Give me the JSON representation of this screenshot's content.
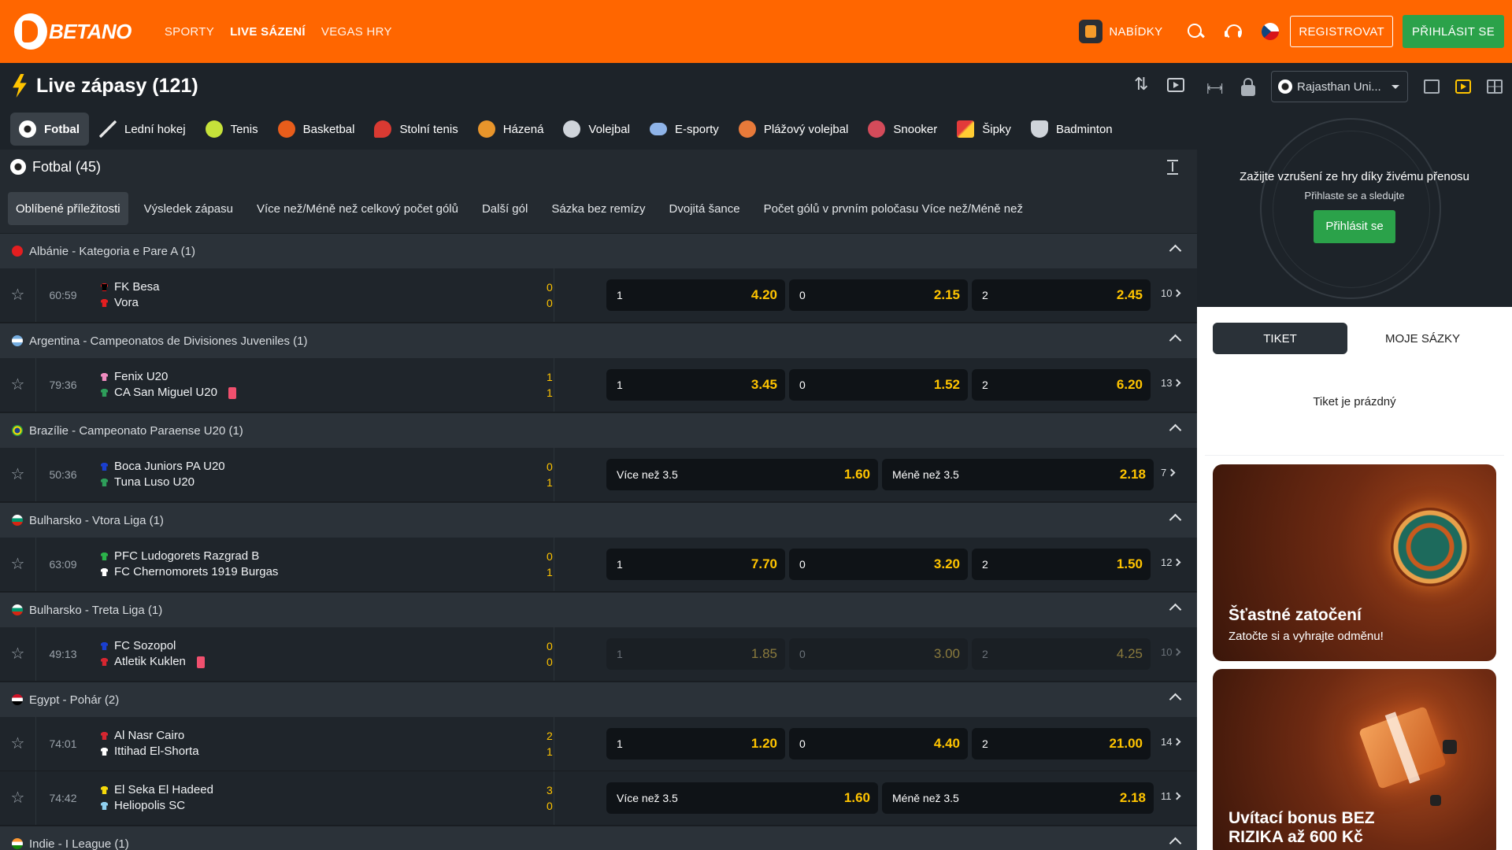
{
  "header": {
    "logo_text": "BETANO",
    "nav": [
      "SPORTY",
      "LIVE SÁZENÍ",
      "VEGAS HRY"
    ],
    "offers_label": "NABÍDKY",
    "register_label": "REGISTROVAT",
    "login_label": "PŘIHLÁSIT SE"
  },
  "live": {
    "title": "Live zápasy (121)"
  },
  "sport_tabs": [
    "Fotbal",
    "Lední hokej",
    "Tenis",
    "Basketbal",
    "Stolní tenis",
    "Házená",
    "Volejbal",
    "E-sporty",
    "Plážový volejbal",
    "Snooker",
    "Šipky",
    "Badminton"
  ],
  "section": {
    "title": "Fotbal (45)"
  },
  "market_tabs": [
    "Oblíbené příležitosti",
    "Výsledek zápasu",
    "Více než/Méně než celkový počet gólů",
    "Další gól",
    "Sázka bez remízy",
    "Dvojitá šance",
    "Počet gólů v prvním poločasu Více než/Méně než"
  ],
  "leagues": [
    {
      "name": "Albánie - Kategoria e Pare A (1)",
      "matches": [
        {
          "time": "60:59",
          "home": "FK Besa",
          "away": "Vora",
          "home_score": "0",
          "away_score": "0",
          "odds": [
            {
              "label": "1",
              "value": "4.20"
            },
            {
              "label": "0",
              "value": "2.15"
            },
            {
              "label": "2",
              "value": "2.45"
            }
          ],
          "more": "10"
        }
      ]
    },
    {
      "name": "Argentina - Campeonatos de Divisiones Juveniles (1)",
      "matches": [
        {
          "time": "79:36",
          "home": "Fenix U20",
          "away": "CA San Miguel U20",
          "home_score": "1",
          "away_score": "1",
          "odds": [
            {
              "label": "1",
              "value": "3.45"
            },
            {
              "label": "0",
              "value": "1.52"
            },
            {
              "label": "2",
              "value": "6.20"
            }
          ],
          "more": "13"
        }
      ]
    },
    {
      "name": "Brazílie - Campeonato Paraense U20 (1)",
      "matches": [
        {
          "time": "50:36",
          "home": "Boca Juniors PA U20",
          "away": "Tuna Luso U20",
          "home_score": "0",
          "away_score": "1",
          "odds": [
            {
              "label": "Více než 3.5",
              "value": "1.60"
            },
            {
              "label": "Méně než 3.5",
              "value": "2.18"
            }
          ],
          "more": "7"
        }
      ]
    },
    {
      "name": "Bulharsko - Vtora Liga (1)",
      "matches": [
        {
          "time": "63:09",
          "home": "PFC Ludogorets Razgrad B",
          "away": "FC Chernomorets 1919 Burgas",
          "home_score": "0",
          "away_score": "1",
          "odds": [
            {
              "label": "1",
              "value": "7.70"
            },
            {
              "label": "0",
              "value": "3.20"
            },
            {
              "label": "2",
              "value": "1.50"
            }
          ],
          "more": "12"
        }
      ]
    },
    {
      "name": "Bulharsko - Treta Liga (1)",
      "matches": [
        {
          "time": "49:13",
          "home": "FC Sozopol",
          "away": "Atletik Kuklen",
          "home_score": "0",
          "away_score": "0",
          "odds": [
            {
              "label": "1",
              "value": "1.85"
            },
            {
              "label": "0",
              "value": "3.00"
            },
            {
              "label": "2",
              "value": "4.25"
            }
          ],
          "more": "10"
        }
      ]
    },
    {
      "name": "Egypt - Pohár (2)",
      "matches": [
        {
          "time": "74:01",
          "home": "Al Nasr Cairo",
          "away": "Ittihad El-Shorta",
          "home_score": "2",
          "away_score": "1",
          "odds": [
            {
              "label": "1",
              "value": "1.20"
            },
            {
              "label": "0",
              "value": "4.40"
            },
            {
              "label": "2",
              "value": "21.00"
            }
          ],
          "more": "14"
        },
        {
          "time": "74:42",
          "home": "El Seka El Hadeed",
          "away": "Heliopolis SC",
          "home_score": "3",
          "away_score": "0",
          "odds": [
            {
              "label": "Více než 3.5",
              "value": "1.60"
            },
            {
              "label": "Méně než 3.5",
              "value": "2.18"
            }
          ],
          "more": "11"
        }
      ]
    },
    {
      "name": "Indie - I League (1)",
      "matches": []
    }
  ],
  "right_panel": {
    "event_select": "Rajasthan Uni...",
    "stream_title": "Zažijte vzrušení ze hry díky živému přenosu",
    "stream_sub": "Přihlaste se a sledujte",
    "stream_login": "Přihlásit se",
    "slip_tabs": [
      "TIKET",
      "MOJE SÁZKY"
    ],
    "slip_empty": "Tiket je prázdný",
    "promo1_title": "Šťastné zatočení",
    "promo1_sub": "Zatočte si a vyhrajte odměnu!",
    "promo2_title_line1": "Uvítací bonus BEZ",
    "promo2_title_line2": "RIZIKA až 600 Kč"
  }
}
